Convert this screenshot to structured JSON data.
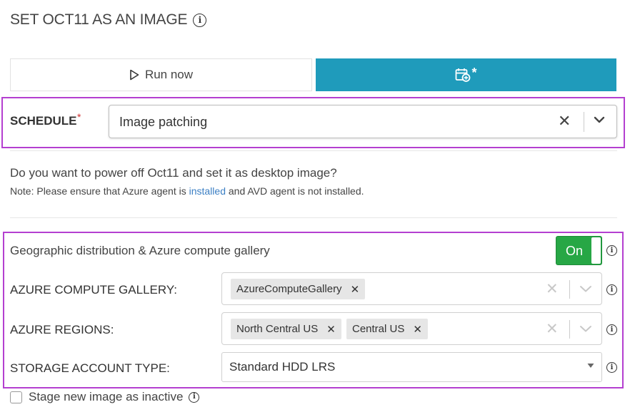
{
  "header": {
    "title": "SET OCT11 AS AN IMAGE",
    "info_icon": "info-icon"
  },
  "tabs": {
    "run_now_label": "Run now",
    "run_now_icon": "play-outline-icon",
    "schedule_icon": "calendar-add-icon",
    "schedule_star": "*",
    "active": "schedule",
    "active_color": "#1f9bbb"
  },
  "schedule": {
    "label": "SCHEDULE",
    "required_mark": "*",
    "value": "Image patching"
  },
  "prompt": {
    "question": "Do you want to power off Oct11 and set it as desktop image?",
    "note_before": "Note: Please ensure that Azure agent is ",
    "note_link": "installed",
    "note_after": " and AVD agent is not installed."
  },
  "geo": {
    "label": "Geographic distribution & Azure compute gallery",
    "toggle_label": "On",
    "toggle_on": true,
    "toggle_color": "#27a745"
  },
  "gallery": {
    "label": "AZURE COMPUTE GALLERY:",
    "chips": [
      "AzureComputeGallery"
    ]
  },
  "regions": {
    "label": "AZURE REGIONS:",
    "chips": [
      "North Central US",
      "Central US"
    ]
  },
  "storage": {
    "label": "STORAGE ACCOUNT TYPE:",
    "value": "Standard HDD LRS"
  },
  "stage": {
    "label": "Stage new image as inactive",
    "checked": false
  },
  "highlight_color": "#b43fd0"
}
